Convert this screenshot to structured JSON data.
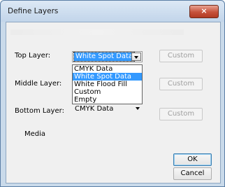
{
  "window": {
    "title": "Define Layers",
    "close_glyph": "×"
  },
  "layers": {
    "top": {
      "label": "Top Layer:",
      "value": "White Spot Data"
    },
    "middle": {
      "label": "Middle Layer:"
    },
    "bottom": {
      "label": "Bottom Layer:",
      "value": "CMYK Data"
    }
  },
  "dropdown": {
    "options": [
      "CMYK Data",
      "White Spot Data",
      "White Flood Fill",
      "Custom",
      "Empty"
    ],
    "highlighted": "White Spot Data"
  },
  "custom_buttons": [
    "Custom",
    "Custom",
    "Custom"
  ],
  "media_label": "Media",
  "buttons": {
    "ok": "OK",
    "cancel": "Cancel"
  }
}
